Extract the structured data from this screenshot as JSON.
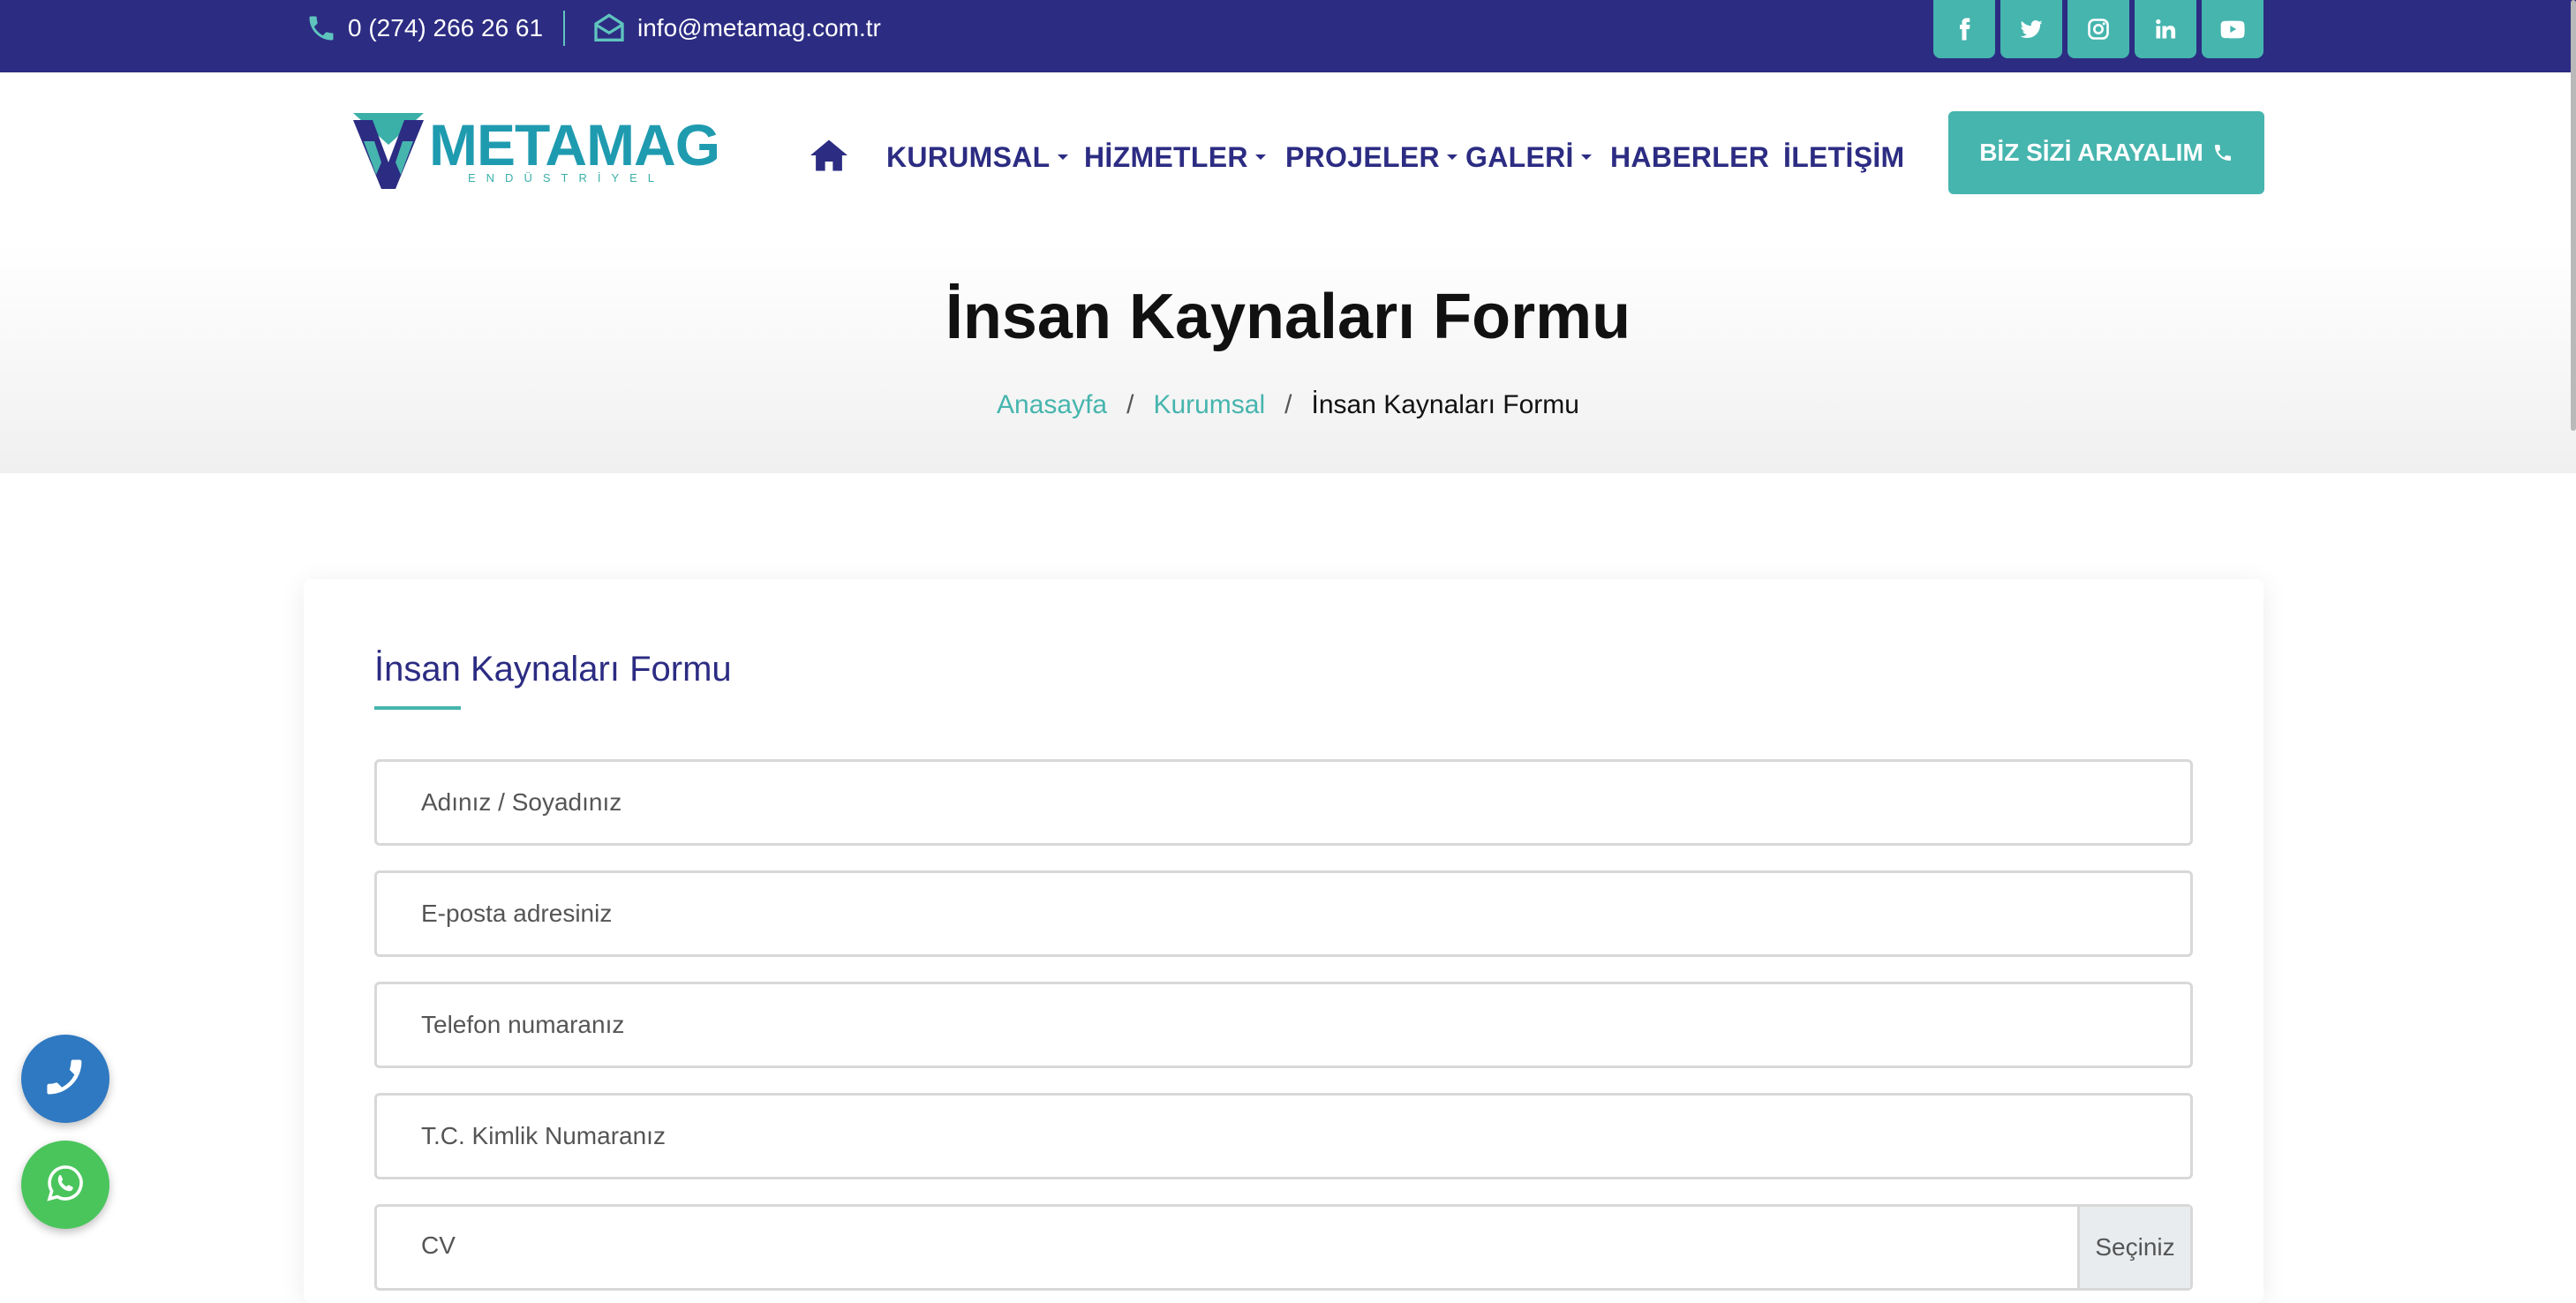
{
  "topbar": {
    "phone": "0 (274) 266 26 61",
    "email": "info@metamag.com.tr",
    "socials": [
      {
        "name": "facebook-icon"
      },
      {
        "name": "twitter-icon"
      },
      {
        "name": "instagram-icon"
      },
      {
        "name": "linkedin-icon"
      },
      {
        "name": "youtube-icon"
      }
    ]
  },
  "logo": {
    "wordmark": "METAMAG",
    "subtitle": "ENDÜSTRİYEL"
  },
  "nav": {
    "items": [
      {
        "label": "KURUMSAL",
        "dropdown": true
      },
      {
        "label": "HİZMETLER",
        "dropdown": true
      },
      {
        "label": "PROJELER",
        "dropdown": true
      },
      {
        "label": "GALERİ",
        "dropdown": true
      },
      {
        "label": "HABERLER",
        "dropdown": false
      },
      {
        "label": "İLETİŞİM",
        "dropdown": false
      }
    ],
    "cta_label": "BİZ SİZİ ARAYALIM"
  },
  "page": {
    "title": "İnsan Kaynaları Formu",
    "breadcrumb": {
      "home": "Anasayfa",
      "parent": "Kurumsal",
      "separator": "/",
      "current": "İnsan Kaynaları Formu"
    }
  },
  "form": {
    "title": "İnsan Kaynaları Formu",
    "fields": {
      "name_placeholder": "Adınız / Soyadınız",
      "email_placeholder": "E-posta adresiniz",
      "phone_placeholder": "Telefon numaranız",
      "tc_placeholder": "T.C. Kimlik Numaranız"
    },
    "cv_label": "CV",
    "cv_browse": "Seçiniz"
  },
  "colors": {
    "brand_navy": "#2c2c83",
    "brand_teal": "#46b5ae",
    "call_button": "#2f79c2",
    "whatsapp_button": "#4ac55c"
  }
}
